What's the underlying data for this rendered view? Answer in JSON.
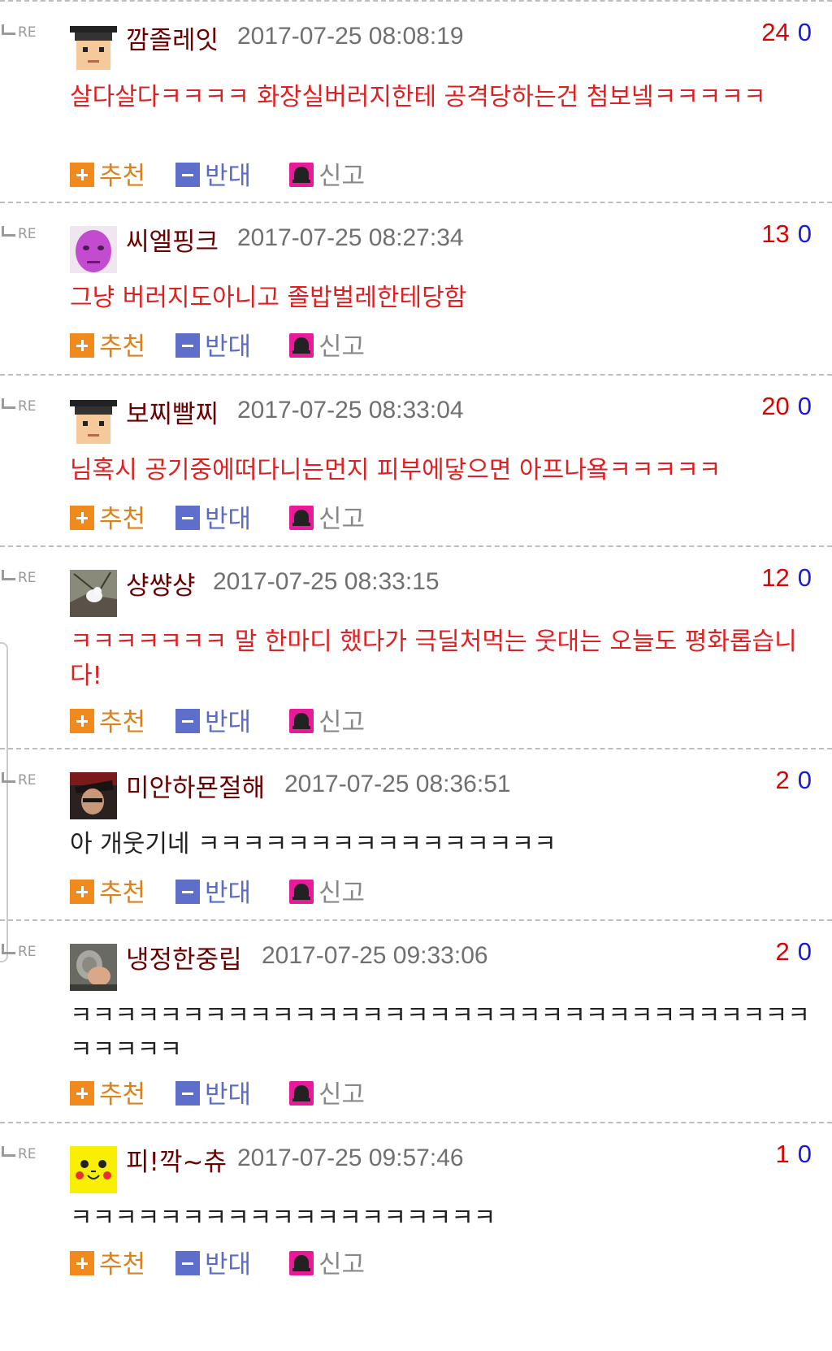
{
  "labels": {
    "re": "RE",
    "recommend": "추천",
    "oppose": "반대",
    "report": "신고"
  },
  "comments": [
    {
      "nick": "깜졸레잇",
      "date": "2017-07-25 08:08:19",
      "up": "24",
      "down": "0",
      "text": "살다살다ㅋㅋㅋㅋ 화장실버러지한테 공격당하는건 첨보넼ㅋㅋㅋㅋㅋ",
      "text_color": "#e02020",
      "avatar": "pixel-man-icon"
    },
    {
      "nick": "씨엘핑크",
      "date": "2017-07-25 08:27:34",
      "up": "13",
      "down": "0",
      "text": "그냥 버러지도아니고 졸밥벌레한테당함",
      "text_color": "#e02020",
      "avatar": "purple-face-icon"
    },
    {
      "nick": "보찌빨찌",
      "date": "2017-07-25 08:33:04",
      "up": "20",
      "down": "0",
      "text": "님혹시 공기중에떠다니는먼지 피부에닿으면 아프나욬ㅋㅋㅋㅋㅋ",
      "text_color": "#e02020",
      "avatar": "pixel-man-icon"
    },
    {
      "nick": "샹썅샹",
      "date": "2017-07-25 08:33:15",
      "up": "12",
      "down": "0",
      "text": "ㅋㅋㅋㅋㅋㅋㅋ 말 한마디 했다가 극딜처먹는 웃대는 오늘도 평화롭습니다!",
      "text_color": "#e02020",
      "avatar": "bird-photo-icon"
    },
    {
      "nick": "미안하묜절해",
      "date": "2017-07-25 08:36:51",
      "up": "2",
      "down": "0",
      "text": "아 개웃기네 ㅋㅋㅋㅋㅋㅋㅋㅋㅋㅋㅋㅋㅋㅋㅋㅋ",
      "text_color": "#222222",
      "avatar": "person-photo-icon"
    },
    {
      "nick": "냉정한중립",
      "date": "2017-07-25 09:33:06",
      "up": "2",
      "down": "0",
      "text": "ㅋㅋㅋㅋㅋㅋㅋㅋㅋㅋㅋㅋㅋㅋㅋㅋㅋㅋㅋㅋㅋㅋㅋㅋㅋㅋㅋㅋㅋㅋㅋㅋㅋㅋㅋㅋㅋㅋ",
      "text_color": "#222222",
      "avatar": "hand-photo-icon"
    },
    {
      "nick": "피!깍~츄",
      "date": "2017-07-25 09:57:46",
      "up": "1",
      "down": "0",
      "text": "ㅋㅋㅋㅋㅋㅋㅋㅋㅋㅋㅋㅋㅋㅋㅋㅋㅋㅋㅋ",
      "text_color": "#222222",
      "avatar": "pikachu-icon"
    }
  ]
}
